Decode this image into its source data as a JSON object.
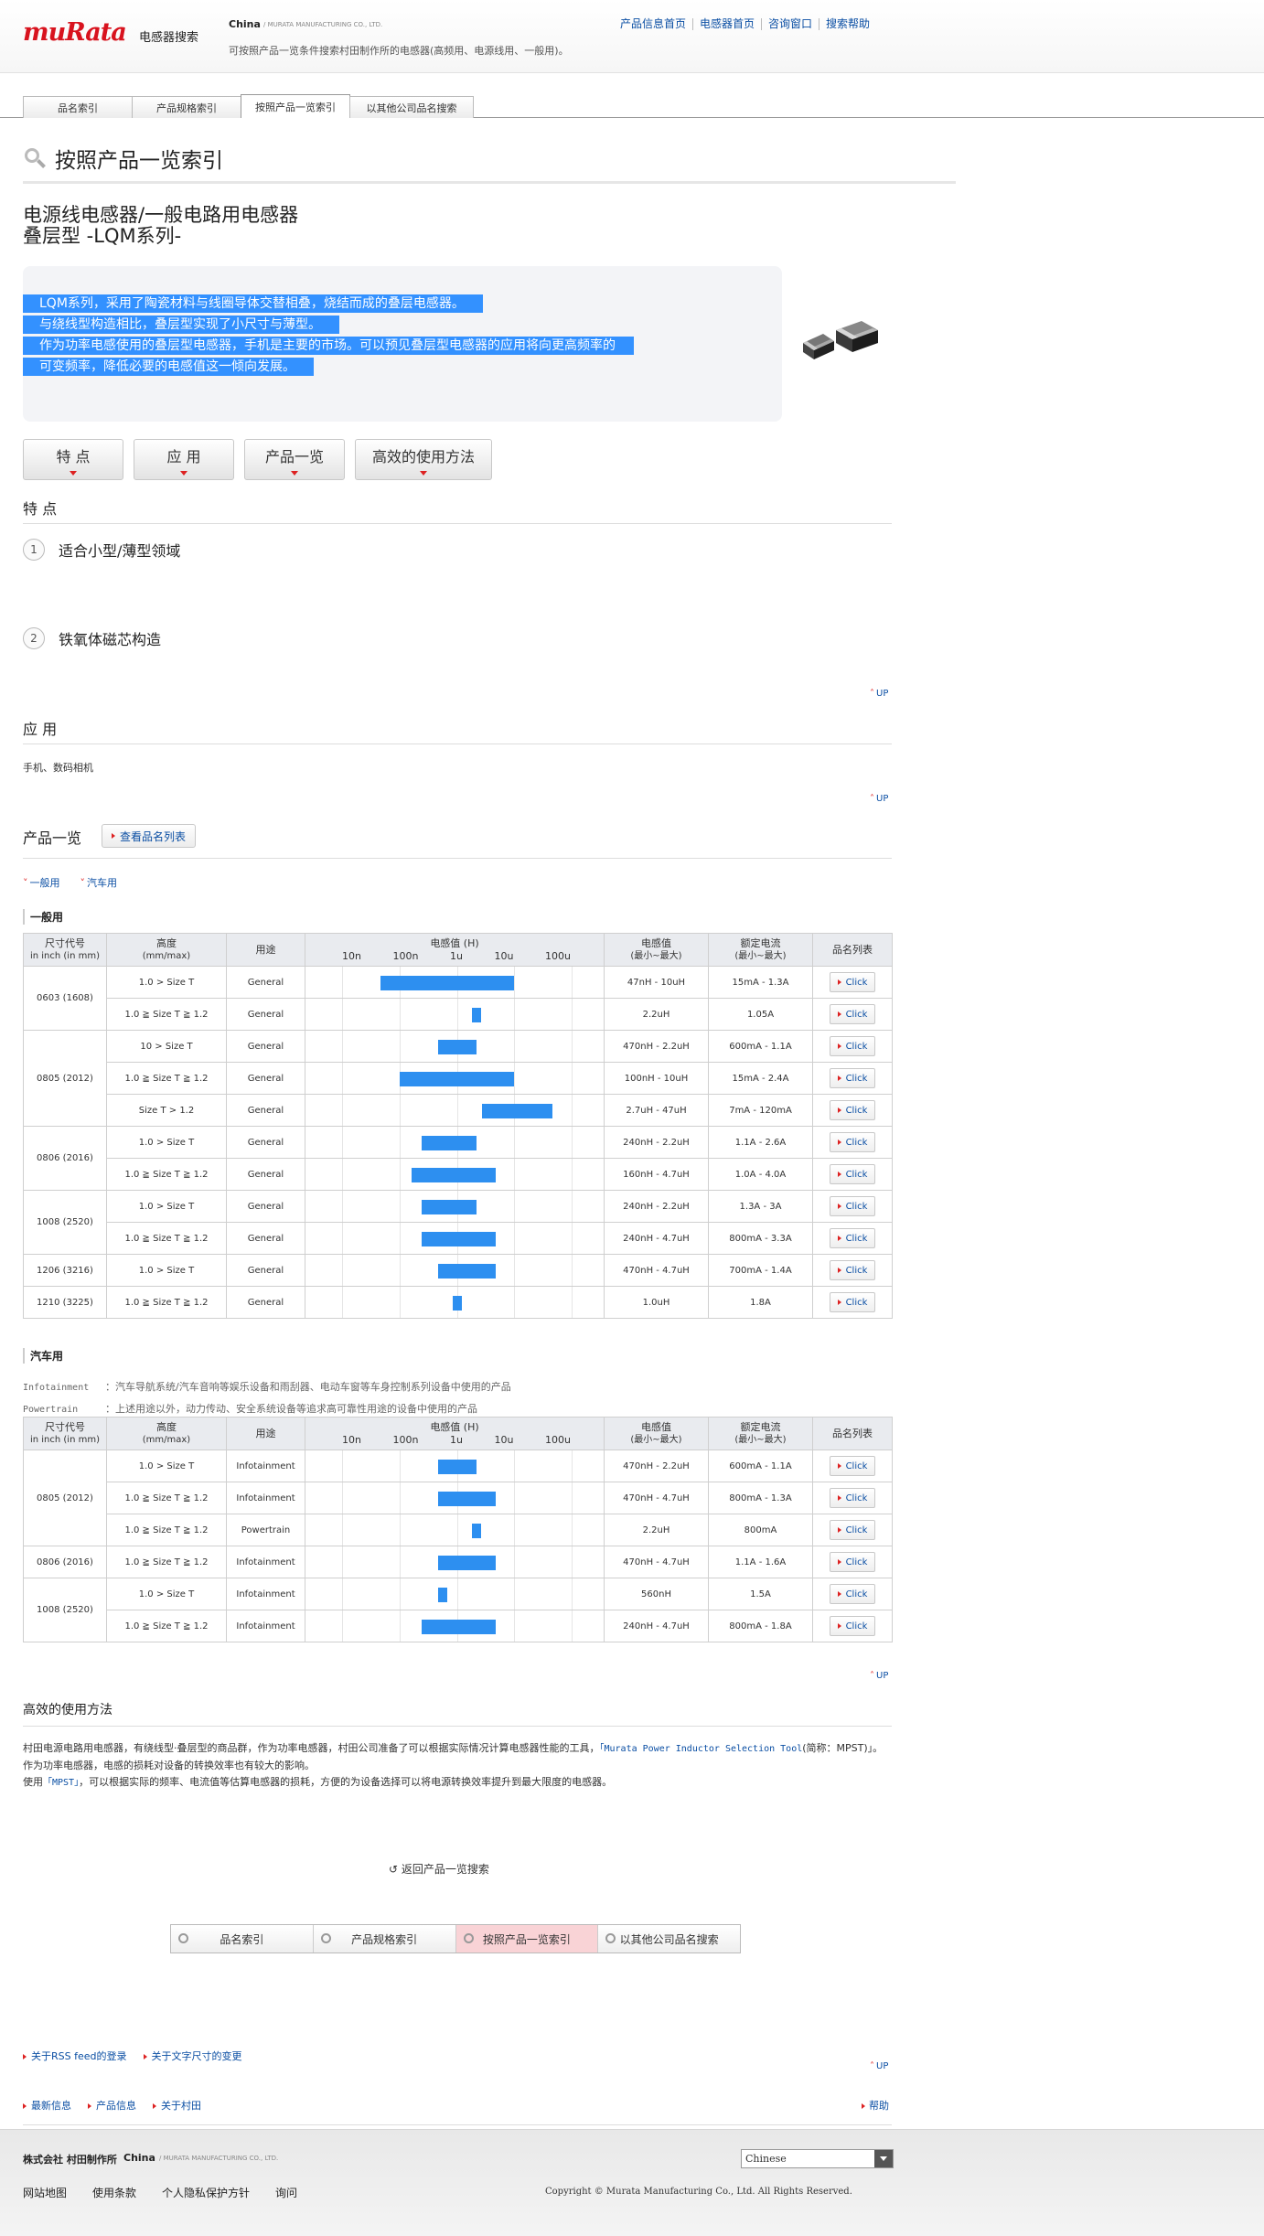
{
  "header": {
    "logo": "muRata",
    "site_name": "电感器搜索",
    "region": "China",
    "region_sub": "/ MURATA MANUFACTURING CO., LTD.",
    "description": "可按照产品一览条件搜索村田制作所的电感器(高频用、电源线用、一般用)。",
    "links": [
      "产品信息首页",
      "电感器首页",
      "咨询窗口",
      "搜索帮助"
    ]
  },
  "tabs": [
    "品名索引",
    "产品规格索引",
    "按照产品一览索引",
    "以其他公司品名搜索"
  ],
  "page_title": "按照产品一览索引",
  "series": {
    "line1": "电源线电感器/一般电路用电感器",
    "line2": "叠层型 -LQM系列-"
  },
  "intro": [
    "LQM系列，采用了陶瓷材料与线圈导体交替相叠，烧结而成的叠层电感器。",
    "与绕线型构造相比，叠层型实现了小尺寸与薄型。",
    "作为功率电感使用的叠层型电感器，手机是主要的市场。可以预见叠层型电感器的应用将向更高频率的",
    "可变频率，降低必要的电感值这一倾向发展。"
  ],
  "anchor_nav": [
    "特 点",
    "应 用",
    "产品一览",
    "高效的使用方法"
  ],
  "features": {
    "heading": "特 点",
    "items": [
      {
        "num": "1",
        "label": "适合小型/薄型领域"
      },
      {
        "num": "2",
        "label": "铁氧体磁芯构造"
      }
    ]
  },
  "up_label": "UP",
  "applications": {
    "heading": "应 用",
    "text": "手机、数码相机"
  },
  "product_list": {
    "heading": "产品一览",
    "button": "查看品名列表",
    "categories": [
      "一般用",
      "汽车用"
    ]
  },
  "table_headers": {
    "size": "尺寸代号",
    "size_sub": "in inch (in mm)",
    "height": "高度",
    "height_sub": "(mm/max)",
    "use": "用途",
    "inductance": "电感值 (H)",
    "range": "电感值",
    "range_sub": "(最小~最大)",
    "current": "额定电流",
    "current_sub": "(最小~最大)",
    "list": "品名列表"
  },
  "chart_scale": [
    "10n",
    "100n",
    "1u",
    "10u",
    "100u"
  ],
  "click_label": "Click",
  "general": {
    "heading": "一般用",
    "groups": [
      {
        "size": "0603 (1608)",
        "rows": [
          {
            "height": "1.0 > Size T",
            "use": "General",
            "range": "47nH - 10uH",
            "current": "15mA - 1.3A"
          },
          {
            "height": "1.0 ≧ Size T ≧ 1.2",
            "use": "General",
            "range": "2.2uH",
            "current": "1.05A"
          }
        ]
      },
      {
        "size": "0805 (2012)",
        "rows": [
          {
            "height": "10 > Size T",
            "use": "General",
            "range": "470nH - 2.2uH",
            "current": "600mA - 1.1A"
          },
          {
            "height": "1.0 ≧ Size T ≧ 1.2",
            "use": "General",
            "range": "100nH - 10uH",
            "current": "15mA - 2.4A"
          },
          {
            "height": "Size T > 1.2",
            "use": "General",
            "range": "2.7uH - 47uH",
            "current": "7mA - 120mA"
          }
        ]
      },
      {
        "size": "0806 (2016)",
        "rows": [
          {
            "height": "1.0 > Size T",
            "use": "General",
            "range": "240nH - 2.2uH",
            "current": "1.1A - 2.6A"
          },
          {
            "height": "1.0 ≧ Size T ≧ 1.2",
            "use": "General",
            "range": "160nH - 4.7uH",
            "current": "1.0A - 4.0A"
          }
        ]
      },
      {
        "size": "1008 (2520)",
        "rows": [
          {
            "height": "1.0 > Size T",
            "use": "General",
            "range": "240nH - 2.2uH",
            "current": "1.3A - 3A"
          },
          {
            "height": "1.0 ≧ Size T ≧ 1.2",
            "use": "General",
            "range": "240nH - 4.7uH",
            "current": "800mA - 3.3A"
          }
        ]
      },
      {
        "size": "1206 (3216)",
        "rows": [
          {
            "height": "1.0 > Size T",
            "use": "General",
            "range": "470nH - 4.7uH",
            "current": "700mA - 1.4A"
          }
        ]
      },
      {
        "size": "1210 (3225)",
        "rows": [
          {
            "height": "1.0 ≧ Size T ≧ 1.2",
            "use": "General",
            "range": "1.0uH",
            "current": "1.8A"
          }
        ]
      }
    ]
  },
  "automotive": {
    "heading": "汽车用",
    "notes": [
      {
        "term": "Infotainment",
        "text": "：汽车导航系统/汽车音响等娱乐设备和雨刮器、电动车窗等车身控制系列设备中使用的产品"
      },
      {
        "term": "Powertrain",
        "text": "：上述用途以外，动力传动、安全系统设备等追求高可靠性用途的设备中使用的产品"
      }
    ],
    "groups": [
      {
        "size": "0805 (2012)",
        "rows": [
          {
            "height": "1.0 > Size T",
            "use": "Infotainment",
            "range": "470nH - 2.2uH",
            "current": "600mA - 1.1A"
          },
          {
            "height": "1.0 ≧ Size T ≧ 1.2",
            "use": "Infotainment",
            "range": "470nH - 4.7uH",
            "current": "800mA - 1.3A"
          },
          {
            "height": "1.0 ≧ Size T ≧ 1.2",
            "use": "Powertrain",
            "range": "2.2uH",
            "current": "800mA"
          }
        ]
      },
      {
        "size": "0806 (2016)",
        "rows": [
          {
            "height": "1.0 ≧ Size T ≧ 1.2",
            "use": "Infotainment",
            "range": "470nH - 4.7uH",
            "current": "1.1A - 1.6A"
          }
        ]
      },
      {
        "size": "1008 (2520)",
        "rows": [
          {
            "height": "1.0 > Size T",
            "use": "Infotainment",
            "range": "560nH",
            "current": "1.5A"
          },
          {
            "height": "1.0 ≧ Size T ≧ 1.2",
            "use": "Infotainment",
            "range": "240nH - 4.7uH",
            "current": "800mA - 1.8A"
          }
        ]
      }
    ]
  },
  "usage": {
    "heading": "高效的使用方法",
    "p1a": "村田电源电路用电感器，有绕线型·叠层型的商品群，作为功率电感器，村田公司准备了可以根据实际情况计算电感器性能的工具，",
    "p1_link": "「Murata Power Inductor Selection Tool",
    "p1b": "(简称：MPST)」。",
    "p2": "作为功率电感器，电感的损耗对设备的转换效率也有较大的影响。",
    "p3a": "使用",
    "p3_link": "「MPST」",
    "p3b": "，可以根据实际的频率、电流值等估算电感器的损耗，方便的为设备选择可以将电源转换效率提升到最大限度的电感器。"
  },
  "back_link": "返回产品一览搜索",
  "bottom_search": [
    "品名索引",
    "产品规格索引",
    "按照产品一览索引",
    "以其他公司品名搜索"
  ],
  "footer_links_1": [
    "关于RSS feed的登录",
    "关于文字尺寸的变更"
  ],
  "footer_links_2": [
    "最新信息",
    "产品信息",
    "关于村田"
  ],
  "help": "帮助",
  "footer": {
    "company": "株式会社 村田制作所",
    "region": "China",
    "region_sub": "/ MURATA MANUFACTURING CO., LTD.",
    "language": "Chinese",
    "nav": [
      "网站地图",
      "使用条款",
      "个人隐私保护方针",
      "询问"
    ],
    "copyright": "Copyright © Murata Manufacturing Co., Ltd. All Rights Reserved."
  },
  "colors": {
    "brand": "#d8131e",
    "link": "#0a4ea3",
    "bar": "#2d8ff0",
    "selection": "#3391ff"
  }
}
